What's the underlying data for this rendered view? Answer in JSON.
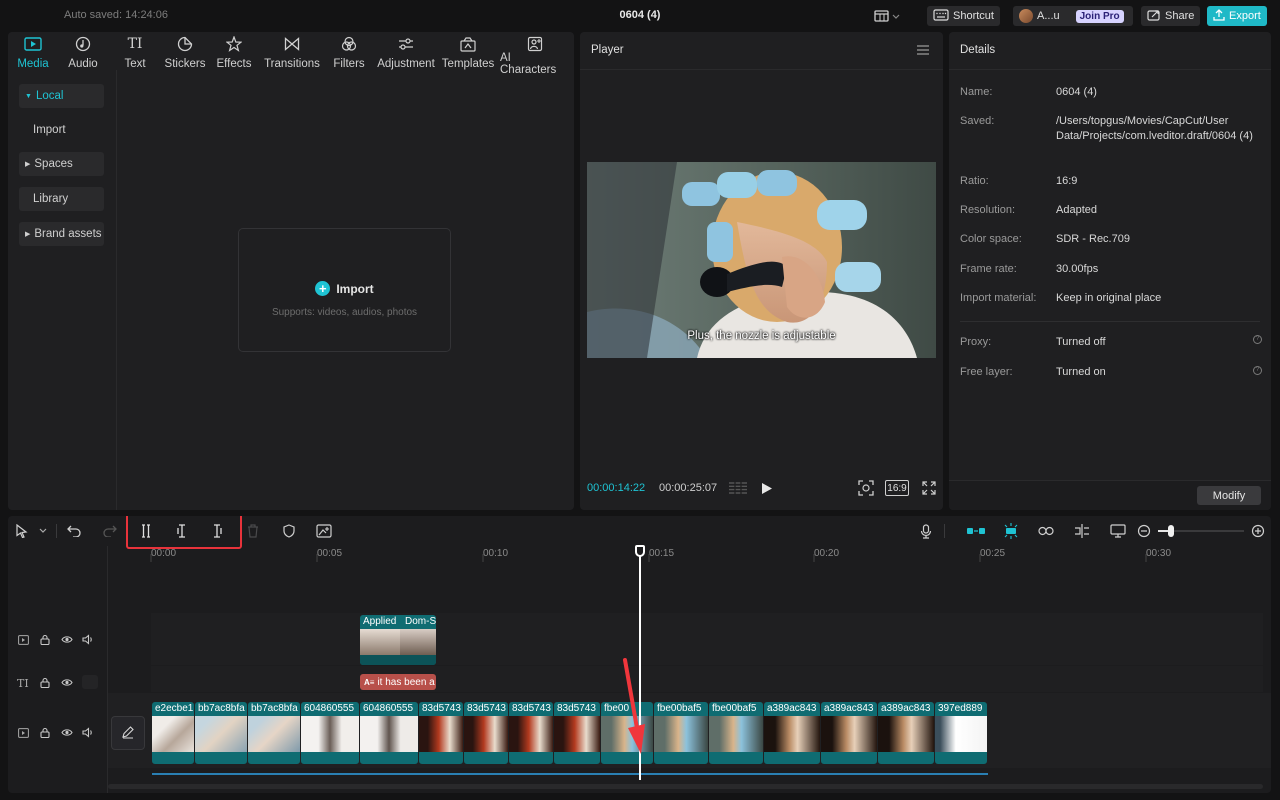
{
  "topbar": {
    "autosaved": "Auto saved: 14:24:06",
    "title": "0604 (4)",
    "shortcut_label": "Shortcut",
    "account_label": "A...u",
    "joinpro_label": "Join Pro",
    "share_label": "Share",
    "export_label": "Export"
  },
  "media": {
    "tabs": [
      {
        "label": "Media",
        "icon": "media-icon"
      },
      {
        "label": "Audio",
        "icon": "audio-icon"
      },
      {
        "label": "Text",
        "icon": "text-icon"
      },
      {
        "label": "Stickers",
        "icon": "stickers-icon"
      },
      {
        "label": "Effects",
        "icon": "effects-icon"
      },
      {
        "label": "Transitions",
        "icon": "transitions-icon"
      },
      {
        "label": "Filters",
        "icon": "filters-icon"
      },
      {
        "label": "Adjustment",
        "icon": "adjustment-icon"
      },
      {
        "label": "Templates",
        "icon": "templates-icon"
      },
      {
        "label": "AI Characters",
        "icon": "ai-characters-icon"
      }
    ],
    "nav": {
      "local": "Local",
      "import": "Import",
      "spaces": "Spaces",
      "library": "Library",
      "brand": "Brand assets"
    },
    "import_label": "Import",
    "import_sub": "Supports: videos, audios, photos"
  },
  "player": {
    "title": "Player",
    "subtitle": "Plus, the nozzle is adjustable",
    "current_time": "00:00:14:22",
    "total_time": "00:00:25:07",
    "ratio_label": "16:9"
  },
  "details": {
    "title": "Details",
    "rows": [
      {
        "label": "Name:",
        "value": "0604 (4)"
      },
      {
        "label": "Saved:",
        "value": "/Users/topgus/Movies/CapCut/User Data/Projects/com.lveditor.draft/0604 (4)"
      },
      {
        "label": "Ratio:",
        "value": "16:9"
      },
      {
        "label": "Resolution:",
        "value": "Adapted"
      },
      {
        "label": "Color space:",
        "value": "SDR - Rec.709"
      },
      {
        "label": "Frame rate:",
        "value": "30.00fps"
      },
      {
        "label": "Import material:",
        "value": "Keep in original place"
      },
      {
        "label": "Proxy:",
        "value": "Turned off"
      },
      {
        "label": "Free layer:",
        "value": "Turned on"
      }
    ],
    "modify_label": "Modify"
  },
  "timeline": {
    "ticks": [
      "00:00",
      "00:05",
      "00:10",
      "00:15",
      "00:20",
      "00:25",
      "00:30"
    ],
    "overlay_clip": {
      "label_a": "Applied",
      "label_b": "Dom-S"
    },
    "text_clip": "it has been a",
    "main_clips": [
      "e2ecbe1",
      "bb7ac8bfa",
      "bb7ac8bfa",
      "604860555",
      "604860555",
      "83d5743",
      "83d5743",
      "83d5743",
      "83d5743",
      "fbe00",
      "fbe00baf5",
      "fbe00baf5",
      "a389ac843",
      "a389ac843",
      "a389ac843",
      "397ed889"
    ]
  },
  "colors": {
    "accent": "#1fc3d3",
    "clip_teal": "#0f6c72",
    "text_clip": "#b8504a",
    "highlight": "#e8333b"
  }
}
